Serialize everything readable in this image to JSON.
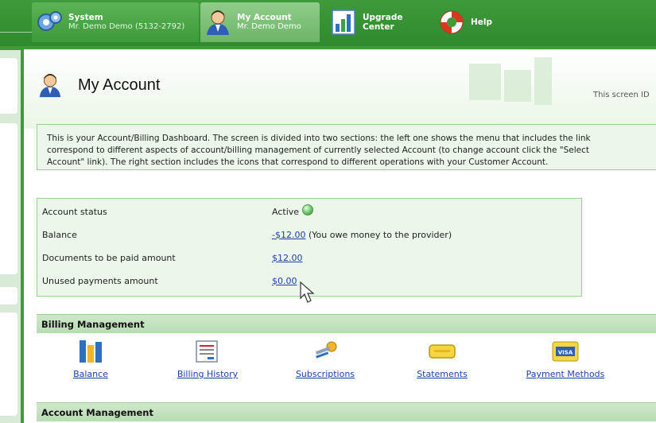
{
  "topbar": {
    "system": {
      "title": "System",
      "subtitle": "Mr. Demo Demo (5132-2792)"
    },
    "account": {
      "title": "My Account",
      "subtitle": "Mr. Demo Demo"
    },
    "upgrade": {
      "title": "Upgrade Center"
    },
    "help": {
      "title": "Help"
    }
  },
  "header": {
    "title": "My Account",
    "screen_id": "This screen ID"
  },
  "description": {
    "line1": "This is your Account/Billing Dashboard. The screen is divided into two sections: the left one shows the menu that includes the link",
    "line2": "correspond to different aspects of account/billing management of currently selected Account (to change account click the \"Select",
    "line3": "Account\" link). The right section includes the icons that correspond to different operations with your Customer Account."
  },
  "status": {
    "rows": [
      {
        "label": "Account status",
        "value": "Active"
      },
      {
        "label": "Balance",
        "value": "-$12.00",
        "note": "(You owe money to the provider)"
      },
      {
        "label": "Documents to be paid amount",
        "value": "$12.00"
      },
      {
        "label": "Unused payments amount",
        "value": "$0.00"
      }
    ]
  },
  "billing": {
    "title": "Billing Management",
    "items": [
      {
        "label": "Balance",
        "icon": "balance-chart-icon"
      },
      {
        "label": "Billing History",
        "icon": "invoice-icon"
      },
      {
        "label": "Subscriptions",
        "icon": "keys-icon"
      },
      {
        "label": "Statements",
        "icon": "statement-icon"
      },
      {
        "label": "Payment Methods",
        "icon": "visa-card-icon"
      }
    ]
  },
  "account_mgmt": {
    "title": "Account Management"
  },
  "colors": {
    "brand_green": "#3f9a3a",
    "panel_bg": "#ecf6ea",
    "link": "#1d3fa8"
  }
}
